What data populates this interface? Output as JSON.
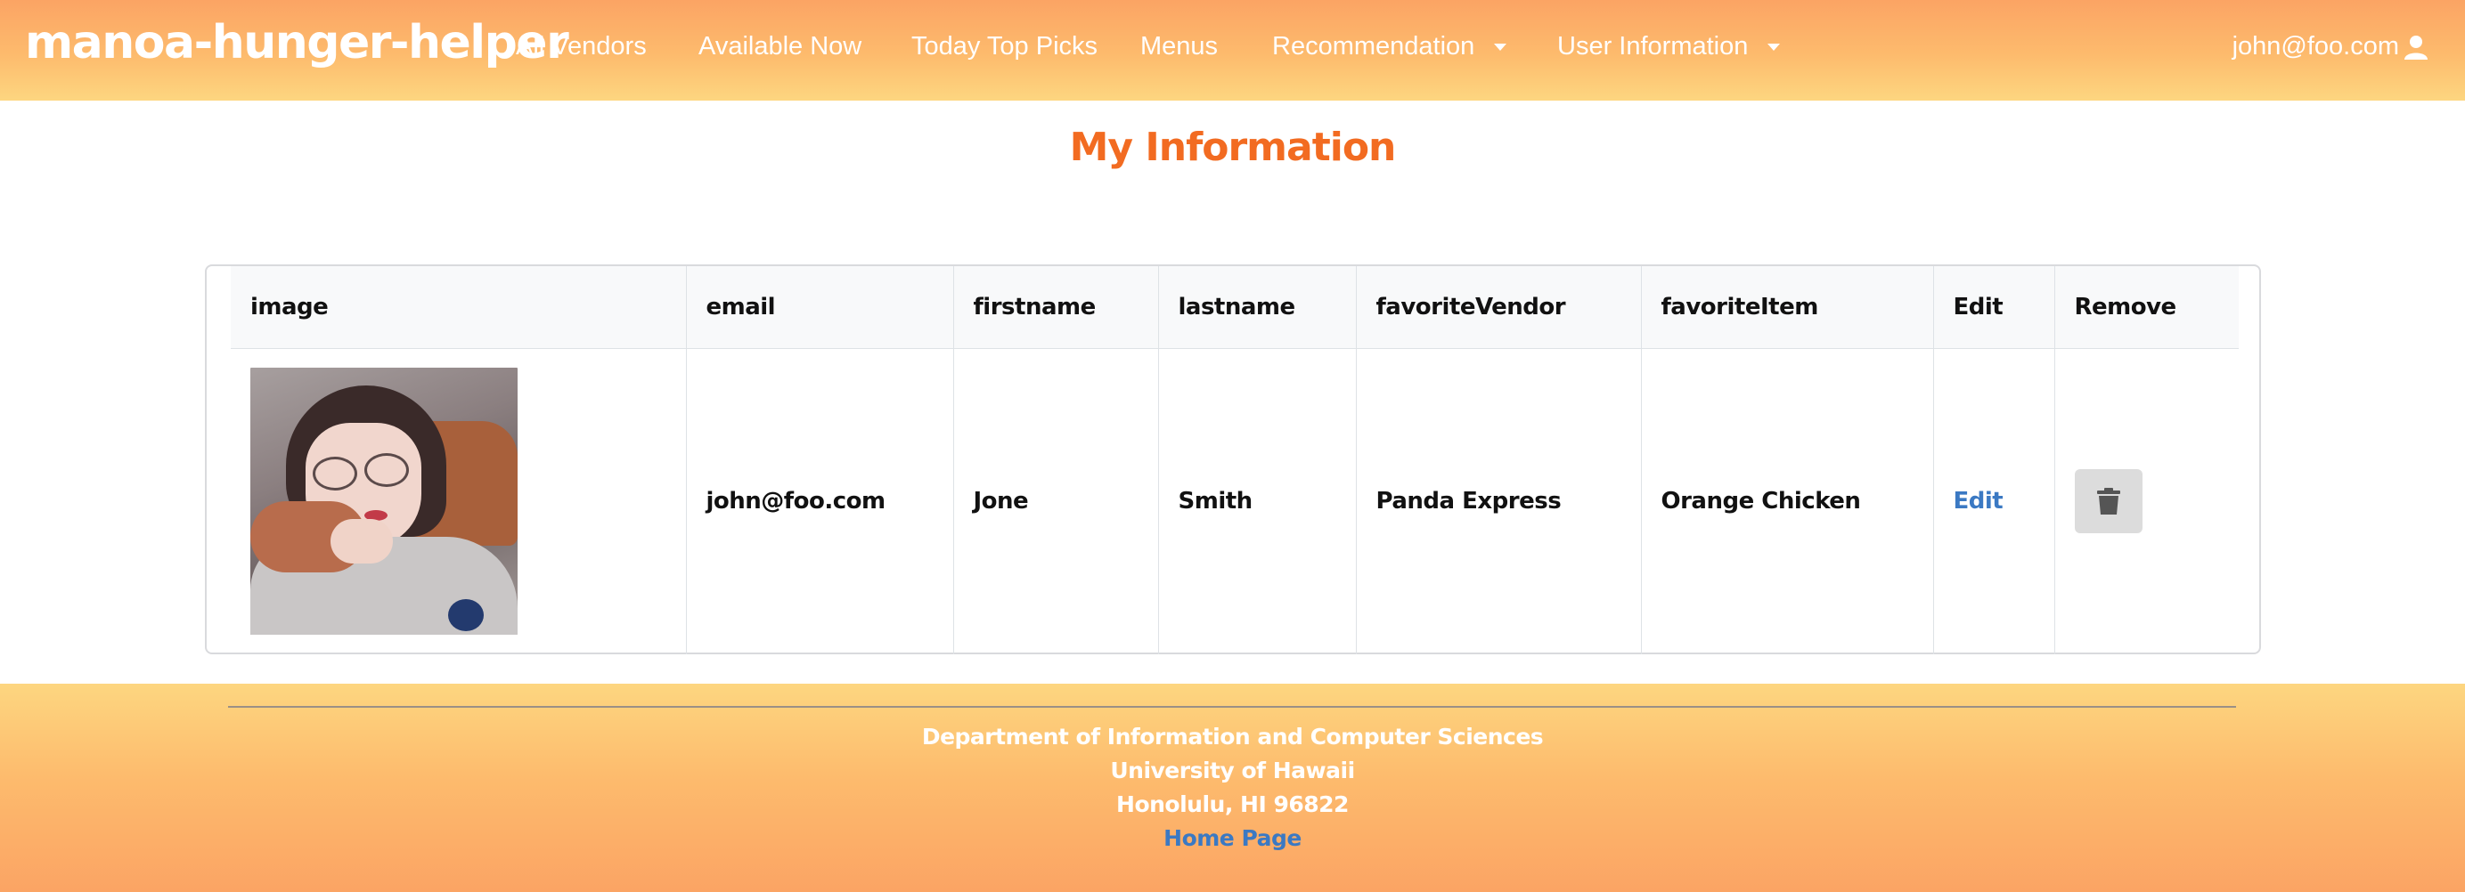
{
  "navbar": {
    "brand": "manoa-hunger-helper",
    "items": [
      {
        "label": "All Vendors"
      },
      {
        "label": "Available Now"
      },
      {
        "label": "Today Top Picks"
      },
      {
        "label": "Menus"
      },
      {
        "label": "Recommendation",
        "dropdown": true
      },
      {
        "label": "User Information",
        "dropdown": true
      }
    ],
    "user_email": "john@foo.com",
    "user_icon": "user-icon"
  },
  "main": {
    "title": "My Information",
    "table": {
      "headers": [
        "image",
        "email",
        "firstname",
        "lastname",
        "favoriteVendor",
        "favoriteItem",
        "Edit",
        "Remove"
      ],
      "rows": [
        {
          "email": "john@foo.com",
          "firstname": "Jone",
          "lastname": "Smith",
          "favoriteVendor": "Panda Express",
          "favoriteItem": "Orange Chicken",
          "edit_label": "Edit",
          "remove_icon": "trash-icon"
        }
      ]
    }
  },
  "footer": {
    "line1": "Department of Information and Computer Sciences",
    "line2": "University of Hawaii",
    "line3": "Honolulu, HI 96822",
    "link": "Home Page"
  },
  "colors": {
    "nav_gradient_top": "#fba464",
    "nav_gradient_bottom": "#fdd680",
    "title": "#f26b21",
    "link": "#3b79c3"
  }
}
